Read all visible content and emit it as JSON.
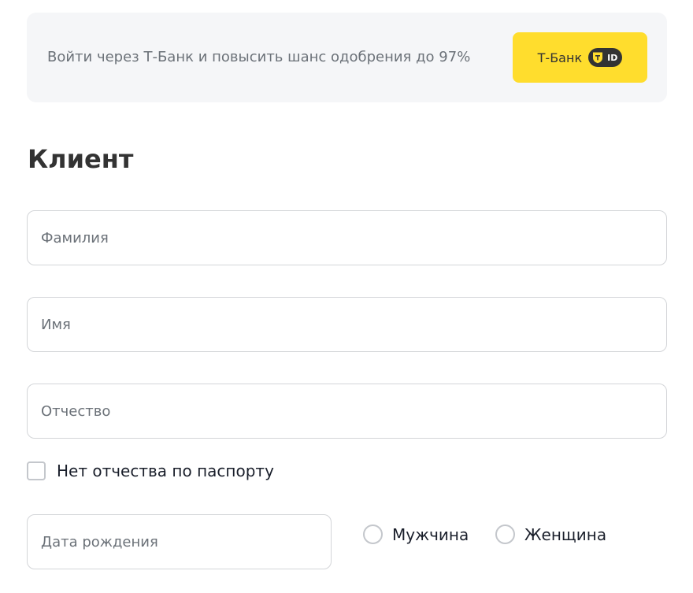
{
  "banner": {
    "text": "Войти через Т-Банк и повысить шанс одобрения до 97%",
    "button_label": "Т-Банк",
    "badge_text": "ID",
    "button_color": "#ffdd2d"
  },
  "section": {
    "title": "Клиент"
  },
  "fields": {
    "last_name": {
      "placeholder": "Фамилия",
      "value": ""
    },
    "first_name": {
      "placeholder": "Имя",
      "value": ""
    },
    "patronymic": {
      "placeholder": "Отчество",
      "value": ""
    },
    "birth_date": {
      "placeholder": "Дата рождения",
      "value": ""
    }
  },
  "no_patronymic": {
    "label": "Нет отчества по паспорту",
    "checked": false
  },
  "gender": {
    "options": [
      {
        "label": "Мужчина",
        "selected": false
      },
      {
        "label": "Женщина",
        "selected": false
      }
    ]
  },
  "icons": {
    "tbank": "tbank-shield-icon"
  }
}
